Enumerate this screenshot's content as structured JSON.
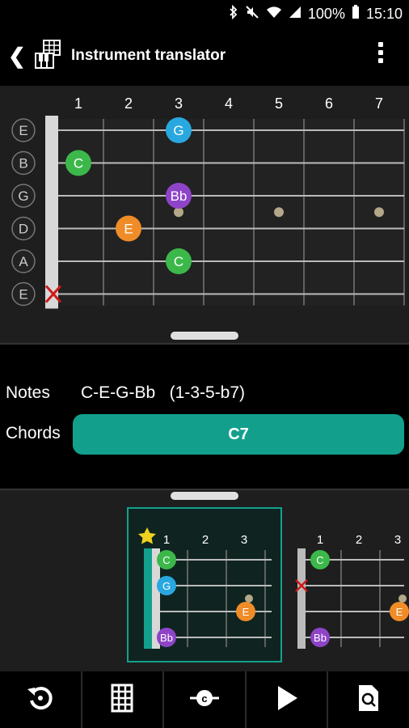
{
  "status": {
    "battery": "100%",
    "time": "15:10"
  },
  "appbar": {
    "title": "Instrument translator"
  },
  "fretboard": {
    "fret_numbers": [
      "1",
      "2",
      "3",
      "4",
      "5",
      "6",
      "7"
    ],
    "strings": [
      "E",
      "B",
      "G",
      "D",
      "A",
      "E"
    ],
    "notes": [
      {
        "string": 0,
        "fret": 3,
        "label": "G",
        "color": "#29a8e0"
      },
      {
        "string": 1,
        "fret": 1,
        "label": "C",
        "color": "#3cb84a"
      },
      {
        "string": 2,
        "fret": 3,
        "label": "Bb",
        "color": "#8e44c8"
      },
      {
        "string": 3,
        "fret": 2,
        "label": "E",
        "color": "#f08c28"
      },
      {
        "string": 4,
        "fret": 3,
        "label": "C",
        "color": "#3cb84a"
      }
    ],
    "muted_string": 5,
    "markers": [
      3,
      5,
      7
    ]
  },
  "info": {
    "notes_label": "Notes",
    "notes_value": "C-E-G-Bb   (1-3-5-b7)",
    "chords_label": "Chords",
    "chord_name": "C7"
  },
  "chord_diagrams": [
    {
      "frets": [
        "1",
        "2",
        "3"
      ],
      "selected": true,
      "starred": true,
      "notes": [
        {
          "string": 0,
          "fret": 0,
          "label": "C",
          "color": "#3cb84a"
        },
        {
          "string": 1,
          "fret": 0,
          "label": "G",
          "color": "#29a8e0"
        },
        {
          "string": 2,
          "fret": 2,
          "label": "E",
          "color": "#f08c28"
        },
        {
          "string": 3,
          "fret": 0,
          "label": "Bb",
          "color": "#8e44c8"
        }
      ]
    },
    {
      "frets": [
        "1",
        "2",
        "3"
      ],
      "selected": false,
      "starred": false,
      "notes": [
        {
          "string": 0,
          "fret": 0,
          "label": "C",
          "color": "#3cb84a"
        },
        {
          "string": 2,
          "fret": 2,
          "label": "E",
          "color": "#f08c28"
        },
        {
          "string": 3,
          "fret": 0,
          "label": "Bb",
          "color": "#8e44c8"
        }
      ]
    }
  ],
  "colors": {
    "accent": "#12a08d",
    "star": "#f0d020",
    "mute": "#d01818"
  },
  "toolbar_icons": [
    "reset-icon",
    "grid-icon",
    "capo-icon",
    "play-icon",
    "search-document-icon"
  ]
}
